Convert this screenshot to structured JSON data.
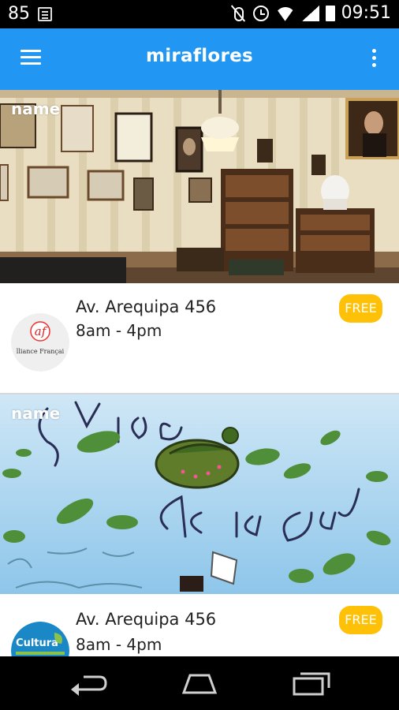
{
  "status_bar": {
    "notification_count": "85",
    "time": "09:51",
    "icons": [
      "notification-icon",
      "mute-icon",
      "alarm-icon",
      "wifi-icon",
      "signal-icon",
      "battery-icon"
    ]
  },
  "app_bar": {
    "title": "miraflores",
    "menu_icon": "hamburger-menu-icon",
    "overflow_icon": "overflow-menu-icon"
  },
  "listings": [
    {
      "name": "name",
      "address": "Av. Arequipa 456",
      "hours": "8am - 4pm",
      "badge": "FREE",
      "logo_text": "af",
      "logo_caption": "lliance Françai"
    },
    {
      "name": "name",
      "address": "Av. Arequipa 456",
      "hours": "8am - 4pm",
      "badge": "FREE",
      "logo_text": "Cultura"
    }
  ],
  "nav_bar": {
    "icons": [
      "back-icon",
      "home-icon",
      "recents-icon"
    ]
  },
  "colors": {
    "app_bar": "#2196f3",
    "badge": "#ffc107"
  }
}
